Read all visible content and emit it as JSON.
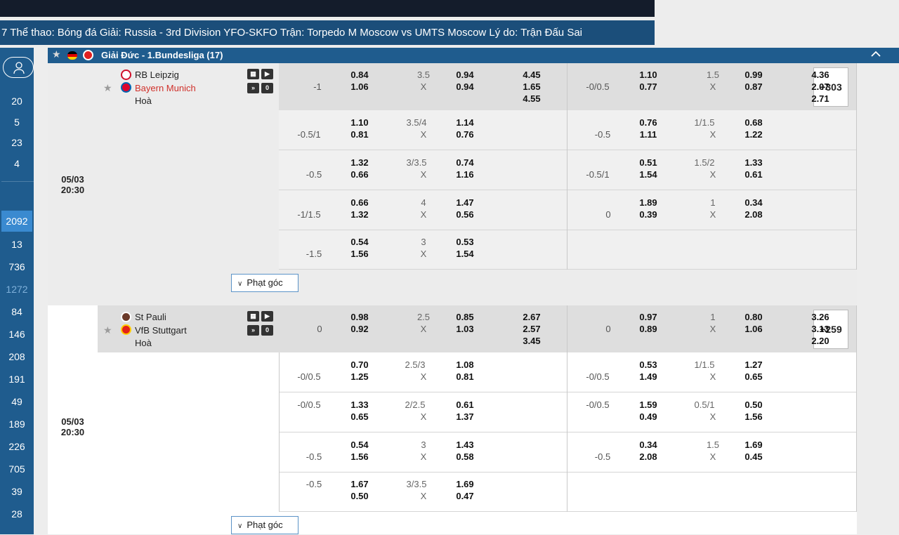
{
  "ticker": "7 Thể thao: Bóng đá Giải: Russia - 3rd Division YFO-SKFO Trận: Torpedo M Moscow vs UMTS Moscow Lý do: Trận Đấu Sai",
  "sidebar": {
    "counts": [
      "20",
      "5",
      "23",
      "4",
      "2092",
      "13",
      "736",
      "1272",
      "84",
      "146",
      "208",
      "191",
      "49",
      "189",
      "226",
      "705",
      "39",
      "28"
    ]
  },
  "league": {
    "name": "Giải Đức - 1.Bundesliga (17)"
  },
  "corner_label": "Phạt góc",
  "matches": [
    {
      "date": "05/03",
      "time": "20:30",
      "home": "RB Leipzig",
      "away": "Bayern Munich",
      "draw": "Hoà",
      "more": "+303",
      "rows": [
        {
          "hdp1": "-1",
          "o1a": "0.84",
          "o1b": "1.06",
          "ou1": "3.5",
          "ou1x": "X",
          "o2a": "0.94",
          "o2b": "0.94",
          "x1": "4.45",
          "x2": "1.65",
          "x3": "4.55",
          "hdp2": "-0/0.5",
          "p1a": "1.10",
          "p1b": "0.77",
          "ou2": "1.5",
          "ou2x": "X",
          "p2a": "0.99",
          "p2b": "0.87",
          "y1": "4.36",
          "y2": "2.07",
          "y3": "2.71"
        },
        {
          "hdp1": "-0.5/1",
          "o1a": "1.10",
          "o1b": "0.81",
          "ou1": "3.5/4",
          "ou1x": "X",
          "o2a": "1.14",
          "o2b": "0.76",
          "hdp2": "-0.5",
          "p1a": "0.76",
          "p1b": "1.11",
          "ou2": "1/1.5",
          "ou2x": "X",
          "p2a": "0.68",
          "p2b": "1.22"
        },
        {
          "hdp1": "-0.5",
          "o1a": "1.32",
          "o1b": "0.66",
          "ou1": "3/3.5",
          "ou1x": "X",
          "o2a": "0.74",
          "o2b": "1.16",
          "hdp2": "-0.5/1",
          "p1a": "0.51",
          "p1b": "1.54",
          "ou2": "1.5/2",
          "ou2x": "X",
          "p2a": "1.33",
          "p2b": "0.61"
        },
        {
          "hdp1": "-1/1.5",
          "o1a": "0.66",
          "o1b": "1.32",
          "ou1": "4",
          "ou1x": "X",
          "o2a": "1.47",
          "o2b": "0.56",
          "hdp2": "0",
          "p1a": "1.89",
          "p1b": "0.39",
          "ou2": "1",
          "ou2x": "X",
          "p2a": "0.34",
          "p2b": "2.08"
        },
        {
          "hdp1": "-1.5",
          "o1a": "0.54",
          "o1b": "1.56",
          "ou1": "3",
          "ou1x": "X",
          "o2a": "0.53",
          "o2b": "1.54"
        }
      ]
    },
    {
      "date": "05/03",
      "time": "20:30",
      "home": "St Pauli",
      "away": "VfB Stuttgart",
      "draw": "Hoà",
      "more": "+259",
      "rows": [
        {
          "hdp1": "0",
          "o1a": "0.98",
          "o1b": "0.92",
          "ou1": "2.5",
          "ou1x": "X",
          "o2a": "0.85",
          "o2b": "1.03",
          "x1": "2.67",
          "x2": "2.57",
          "x3": "3.45",
          "hdp2": "0",
          "p1a": "0.97",
          "p1b": "0.89",
          "ou2": "1",
          "ou2x": "X",
          "p2a": "0.80",
          "p2b": "1.06",
          "y1": "3.26",
          "y2": "3.13",
          "y3": "2.20"
        },
        {
          "hdp1": "-0/0.5",
          "o1a": "0.70",
          "o1b": "1.25",
          "ou1": "2.5/3",
          "ou1x": "X",
          "o2a": "1.08",
          "o2b": "0.81",
          "hdp2": "-0/0.5",
          "p1a": "0.53",
          "p1b": "1.49",
          "ou2": "1/1.5",
          "ou2x": "X",
          "p2a": "1.27",
          "p2b": "0.65"
        },
        {
          "hdp1": "-0/0.5",
          "o1a": "1.33",
          "o1b": "0.65",
          "ou1": "2/2.5",
          "ou1x": "X",
          "o2a": "0.61",
          "o2b": "1.37",
          "hdp2": "-0/0.5",
          "p1a": "1.59",
          "p1b": "0.49",
          "ou2": "0.5/1",
          "ou2x": "X",
          "p2a": "0.50",
          "p2b": "1.56"
        },
        {
          "hdp1": "-0.5",
          "o1a": "0.54",
          "o1b": "1.56",
          "ou1": "3",
          "ou1x": "X",
          "o2a": "1.43",
          "o2b": "0.58",
          "hdp2": "-0.5",
          "p1a": "0.34",
          "p1b": "2.08",
          "ou2": "1.5",
          "ou2x": "X",
          "p2a": "1.69",
          "p2b": "0.45"
        },
        {
          "hdp1": "-0.5",
          "o1a": "1.67",
          "o1b": "0.50",
          "ou1": "3/3.5",
          "ou1x": "X",
          "o2a": "1.69",
          "o2b": "0.47"
        }
      ]
    }
  ]
}
